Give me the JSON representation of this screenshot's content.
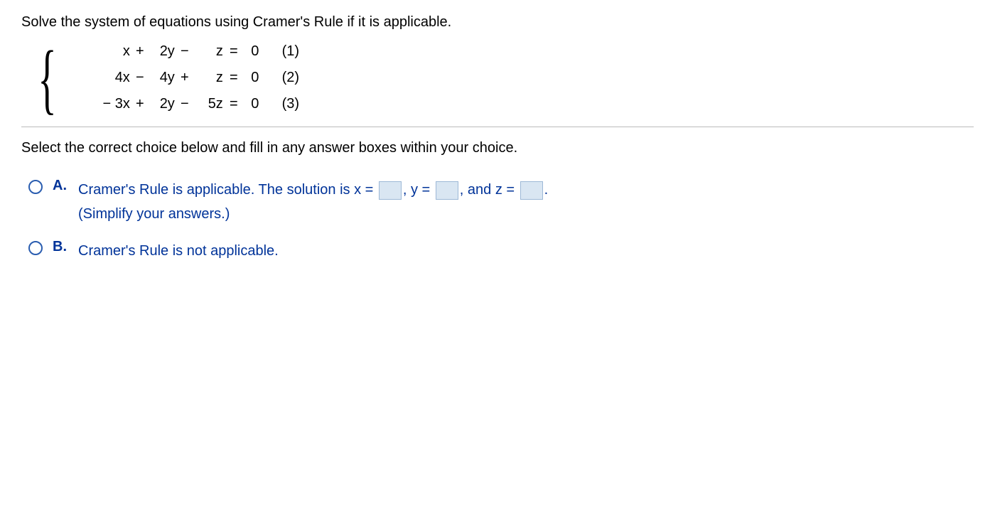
{
  "question": "Solve the system of equations using Cramer's Rule if it is applicable.",
  "equations": [
    {
      "x": "x",
      "op1": "+",
      "y": "2y",
      "op2": "−",
      "z": "z",
      "eq": "=",
      "rhs": "0",
      "num": "(1)"
    },
    {
      "x": "4x",
      "op1": "−",
      "y": "4y",
      "op2": "+",
      "z": "z",
      "eq": "=",
      "rhs": "0",
      "num": "(2)"
    },
    {
      "x": "− 3x",
      "op1": "+",
      "y": "2y",
      "op2": "−",
      "z": "5z",
      "eq": "=",
      "rhs": "0",
      "num": "(3)"
    }
  ],
  "instruction": "Select the correct choice below and fill in any answer boxes within your choice.",
  "choiceA": {
    "label": "A.",
    "part1": "Cramer's Rule is applicable. The solution is x =",
    "part2": ", y =",
    "part3": ", and z =",
    "part4": ".",
    "hint": "(Simplify your answers.)"
  },
  "choiceB": {
    "label": "B.",
    "text": "Cramer's Rule is not applicable."
  }
}
